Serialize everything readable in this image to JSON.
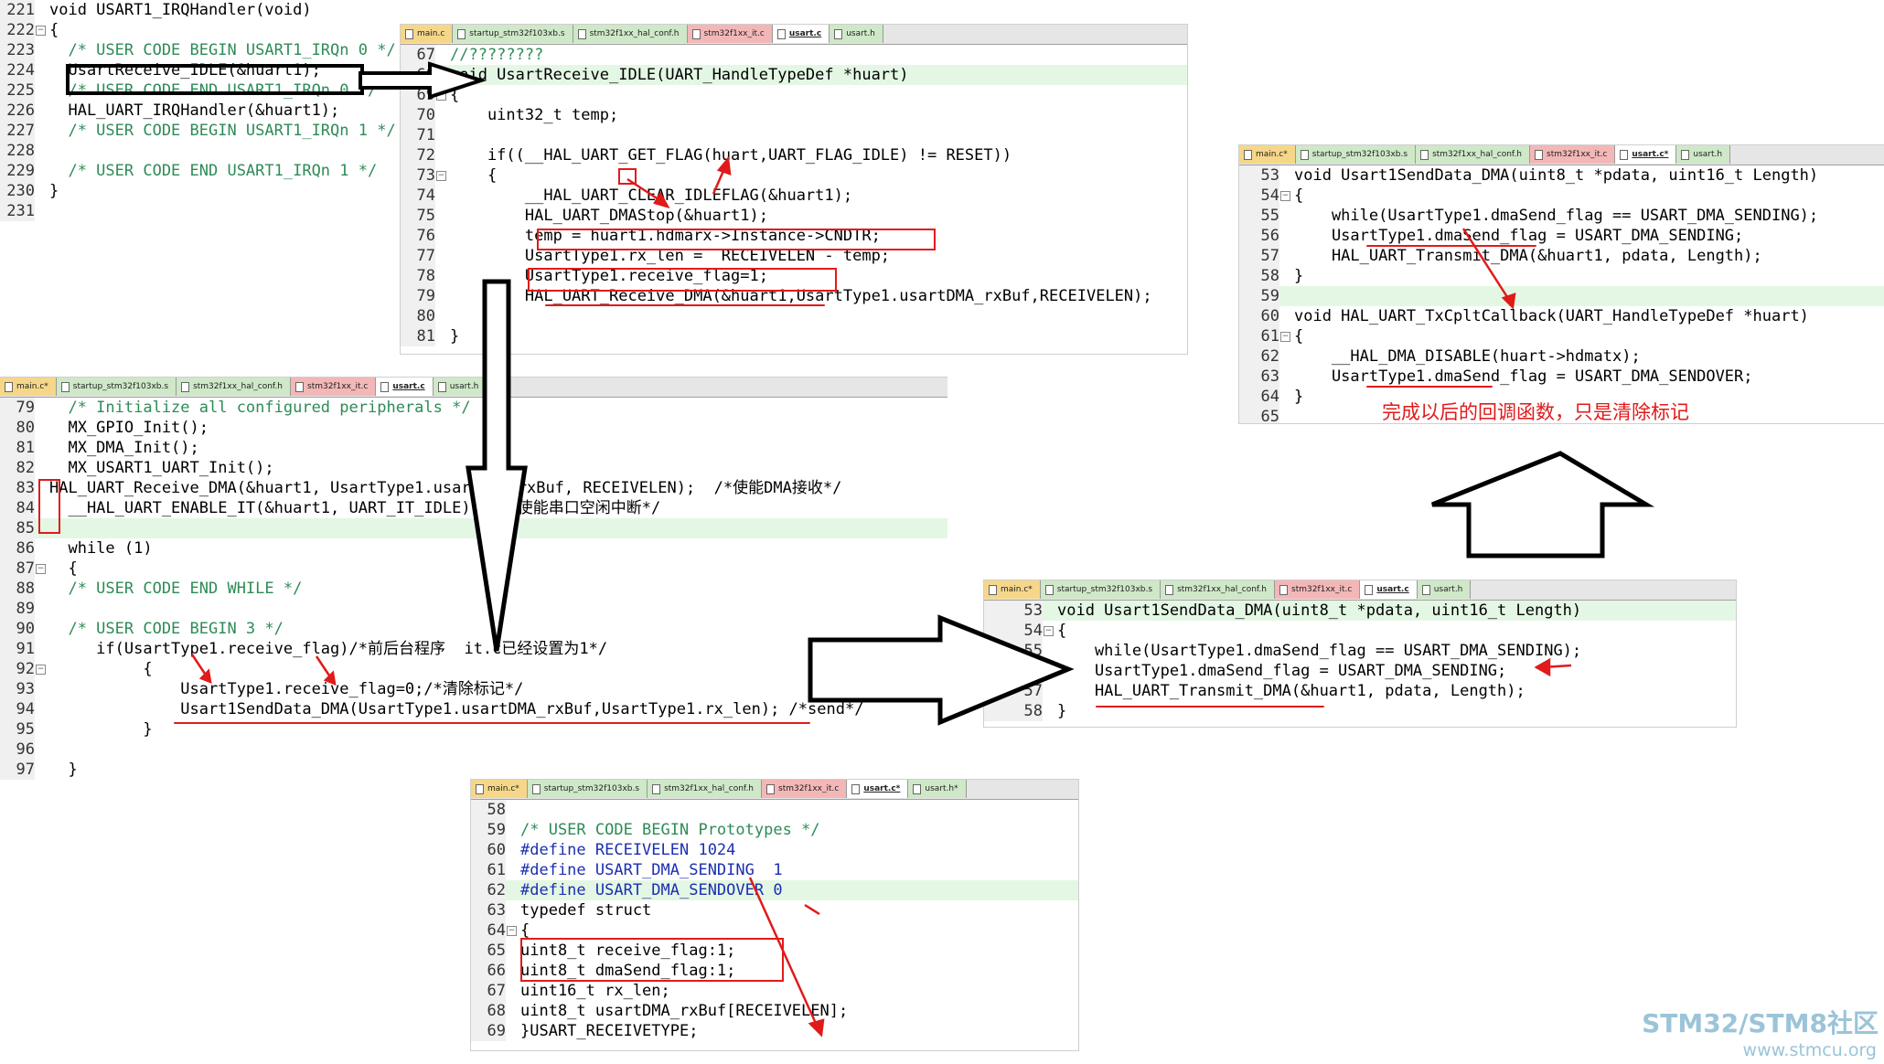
{
  "panels": {
    "p1": {
      "lines": [
        {
          "n": "221",
          "t": "void USART1_IRQHandler(void)"
        },
        {
          "n": "222",
          "t": "{"
        },
        {
          "n": "223",
          "t": "  /* USER CODE BEGIN USART1_IRQn 0 */"
        },
        {
          "n": "224",
          "t": "  UsartReceive_IDLE(&huart1);"
        },
        {
          "n": "225",
          "t": "  /* USER CODE END USART1_IRQn 0 */"
        },
        {
          "n": "226",
          "t": "  HAL_UART_IRQHandler(&huart1);"
        },
        {
          "n": "227",
          "t": "  /* USER CODE BEGIN USART1_IRQn 1 */"
        },
        {
          "n": "228",
          "t": ""
        },
        {
          "n": "229",
          "t": "  /* USER CODE END USART1_IRQn 1 */"
        },
        {
          "n": "230",
          "t": "}"
        },
        {
          "n": "231",
          "t": ""
        }
      ]
    },
    "p2": {
      "tabs": [
        "main.c",
        "startup_stm32f103xb.s",
        "stm32f1xx_hal_conf.h",
        "stm32f1xx_it.c",
        "usart.c",
        "usart.h"
      ],
      "lines": [
        {
          "n": "67",
          "t": "//????????"
        },
        {
          "n": "68",
          "t": "void UsartReceive_IDLE(UART_HandleTypeDef *huart)"
        },
        {
          "n": "69",
          "t": "{"
        },
        {
          "n": "70",
          "t": "    uint32_t temp;"
        },
        {
          "n": "71",
          "t": ""
        },
        {
          "n": "72",
          "t": "    if((__HAL_UART_GET_FLAG(huart,UART_FLAG_IDLE) != RESET))"
        },
        {
          "n": "73",
          "t": "    {"
        },
        {
          "n": "74",
          "t": "        __HAL_UART_CLEAR_IDLEFLAG(&huart1);"
        },
        {
          "n": "75",
          "t": "        HAL_UART_DMAStop(&huart1);"
        },
        {
          "n": "76",
          "t": "        temp = huart1.hdmarx->Instance->CNDTR;"
        },
        {
          "n": "77",
          "t": "        UsartType1.rx_len =  RECEIVELEN - temp;"
        },
        {
          "n": "78",
          "t": "        UsartType1.receive_flag=1;"
        },
        {
          "n": "79",
          "t": "        HAL_UART_Receive_DMA(&huart1,UsartType1.usartDMA_rxBuf,RECEIVELEN);"
        },
        {
          "n": "80",
          "t": "    }"
        },
        {
          "n": "81",
          "t": "}"
        }
      ]
    },
    "p3": {
      "tabs": [
        "main.c*",
        "startup_stm32f103xb.s",
        "stm32f1xx_hal_conf.h",
        "stm32f1xx_it.c",
        "usart.c",
        "usart.h"
      ],
      "lines": [
        {
          "n": "79",
          "t": "  /* Initialize all configured peripherals */"
        },
        {
          "n": "80",
          "t": "  MX_GPIO_Init();"
        },
        {
          "n": "81",
          "t": "  MX_DMA_Init();"
        },
        {
          "n": "82",
          "t": "  MX_USART1_UART_Init();"
        },
        {
          "n": "83",
          "t": "HAL_UART_Receive_DMA(&huart1, UsartType1.usartDMA_rxBuf, RECEIVELEN);  /*使能DMA接收*/"
        },
        {
          "n": "84",
          "t": "  __HAL_UART_ENABLE_IT(&huart1, UART_IT_IDLE);  /*使能串口空闲中断*/"
        },
        {
          "n": "85",
          "t": ""
        },
        {
          "n": "86",
          "t": "  while (1)"
        },
        {
          "n": "87",
          "t": "  {"
        },
        {
          "n": "88",
          "t": "  /* USER CODE END WHILE */"
        },
        {
          "n": "89",
          "t": ""
        },
        {
          "n": "90",
          "t": "  /* USER CODE BEGIN 3 */"
        },
        {
          "n": "91",
          "t": "     if(UsartType1.receive_flag)/*前后台程序  it.c已经设置为1*/"
        },
        {
          "n": "92",
          "t": "          {"
        },
        {
          "n": "93",
          "t": "              UsartType1.receive_flag=0;/*清除标记*/"
        },
        {
          "n": "94",
          "t": "              Usart1SendData_DMA(UsartType1.usartDMA_rxBuf,UsartType1.rx_len); /*send*/"
        },
        {
          "n": "95",
          "t": "          }"
        },
        {
          "n": "96",
          "t": ""
        },
        {
          "n": "97",
          "t": "  }"
        }
      ]
    },
    "p4": {
      "tabs": [
        "main.c*",
        "startup_stm32f103xb.s",
        "stm32f1xx_hal_conf.h",
        "stm32f1xx_it.c",
        "usart.c*",
        "usart.h"
      ],
      "lines": [
        {
          "n": "53",
          "t": "void Usart1SendData_DMA(uint8_t *pdata, uint16_t Length)"
        },
        {
          "n": "54",
          "t": "{"
        },
        {
          "n": "55",
          "t": "    while(UsartType1.dmaSend_flag == USART_DMA_SENDING);"
        },
        {
          "n": "56",
          "t": "    UsartType1.dmaSend_flag = USART_DMA_SENDING;"
        },
        {
          "n": "57",
          "t": "    HAL_UART_Transmit_DMA(&huart1, pdata, Length);"
        },
        {
          "n": "58",
          "t": "}"
        },
        {
          "n": "59",
          "t": ""
        },
        {
          "n": "60",
          "t": "void HAL_UART_TxCpltCallback(UART_HandleTypeDef *huart)"
        },
        {
          "n": "61",
          "t": "{"
        },
        {
          "n": "62",
          "t": "    __HAL_DMA_DISABLE(huart->hdmatx);"
        },
        {
          "n": "63",
          "t": "    UsartType1.dmaSend_flag = USART_DMA_SENDOVER;"
        },
        {
          "n": "64",
          "t": "}"
        },
        {
          "n": "65",
          "t": ""
        }
      ],
      "annotation": "完成以后的回调函数，只是清除标记"
    },
    "p5": {
      "tabs": [
        "main.c*",
        "startup_stm32f103xb.s",
        "stm32f1xx_hal_conf.h",
        "stm32f1xx_it.c",
        "usart.c",
        "usart.h"
      ],
      "lines": [
        {
          "n": "53",
          "t": "void Usart1SendData_DMA(uint8_t *pdata, uint16_t Length)"
        },
        {
          "n": "54",
          "t": "{"
        },
        {
          "n": "55",
          "t": "    while(UsartType1.dmaSend_flag == USART_DMA_SENDING);"
        },
        {
          "n": "56",
          "t": "    UsartType1.dmaSend_flag = USART_DMA_SENDING;"
        },
        {
          "n": "57",
          "t": "    HAL_UART_Transmit_DMA(&huart1, pdata, Length);"
        },
        {
          "n": "58",
          "t": "}"
        }
      ]
    },
    "p6": {
      "tabs": [
        "main.c*",
        "startup_stm32f103xb.s",
        "stm32f1xx_hal_conf.h",
        "stm32f1xx_it.c",
        "usart.c*",
        "usart.h*"
      ],
      "lines": [
        {
          "n": "58",
          "t": ""
        },
        {
          "n": "59",
          "t": "/* USER CODE BEGIN Prototypes */"
        },
        {
          "n": "60",
          "t": "#define RECEIVELEN 1024"
        },
        {
          "n": "61",
          "t": "#define USART_DMA_SENDING  1"
        },
        {
          "n": "62",
          "t": "#define USART_DMA_SENDOVER 0"
        },
        {
          "n": "63",
          "t": "typedef struct"
        },
        {
          "n": "64",
          "t": "{"
        },
        {
          "n": "65",
          "t": "uint8_t receive_flag:1;"
        },
        {
          "n": "66",
          "t": "uint8_t dmaSend_flag:1;"
        },
        {
          "n": "67",
          "t": "uint16_t rx_len;"
        },
        {
          "n": "68",
          "t": "uint8_t usartDMA_rxBuf[RECEIVELEN];"
        },
        {
          "n": "69",
          "t": "}USART_RECEIVETYPE;"
        }
      ]
    }
  },
  "watermark": {
    "brand": "STM32/STM8社区",
    "url": "www.stmcu.org"
  }
}
